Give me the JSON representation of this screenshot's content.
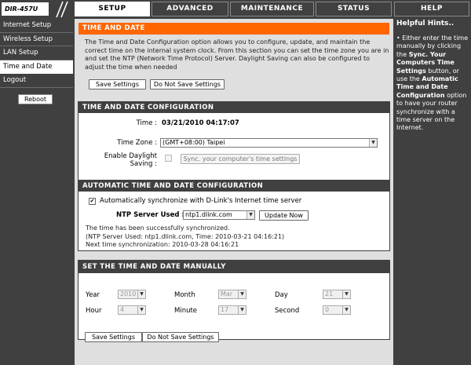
{
  "header": {
    "logo": "DIR-457U",
    "tabs": [
      {
        "label": "SETUP"
      },
      {
        "label": "ADVANCED"
      },
      {
        "label": "MAINTENANCE"
      },
      {
        "label": "STATUS"
      },
      {
        "label": "HELP"
      }
    ]
  },
  "sidebar": {
    "items": [
      {
        "label": "Internet Setup"
      },
      {
        "label": "Wireless Setup"
      },
      {
        "label": "LAN Setup"
      },
      {
        "label": "Time and Date"
      },
      {
        "label": "Logout"
      }
    ],
    "reboot_label": "Reboot"
  },
  "intro": {
    "title": "TIME AND DATE",
    "text": "The Time and Date Configuration option allows you to configure, update, and maintain the correct time on the internal system clock. From this section you can set the time zone you are in and set the NTP (Network Time Protocol) Server. Daylight Saving can also be configured to adjust the time when needed",
    "save_label": "Save Settings",
    "nosave_label": "Do Not Save Settings"
  },
  "config": {
    "title": "TIME AND DATE CONFIGURATION",
    "time_label": "Time :",
    "time_value": "03/21/2010 04:17:07",
    "timezone_label": "Time Zone :",
    "timezone_value": "(GMT+08:00) Taipei",
    "daylight_label_1": "Enable Daylight",
    "daylight_label_2": "Saving :",
    "sync_label": "Sync. your computer's time settings"
  },
  "auto": {
    "title": "AUTOMATIC TIME AND DATE CONFIGURATION",
    "checkbox_label": "Automatically synchronize with D-Link's Internet time server",
    "ntp_label": "NTP Server Used :",
    "ntp_value": "ntp1.dlink.com",
    "update_label": "Update Now",
    "status_1": "The time has been successfully synchronized.",
    "status_2": "(NTP Server Used: ntp1.dlink.com, Time: 2010-03-21 04:16:21)",
    "status_3": "Next time synchronization: 2010-03-28 04:16:21"
  },
  "manual": {
    "title": "SET THE TIME AND DATE MANUALLY",
    "year_label": "Year",
    "year_value": "2010",
    "month_label": "Month",
    "month_value": "Mar",
    "day_label": "Day",
    "day_value": "21",
    "hour_label": "Hour",
    "hour_value": "4",
    "minute_label": "Minute",
    "minute_value": "17",
    "second_label": "Second",
    "second_value": "0"
  },
  "footer": {
    "save_label": "Save Settings",
    "nosave_label": "Do Not Save Settings"
  },
  "hints": {
    "title": "Helpful Hints..",
    "bullet": "•",
    "p1": "Either enter the time manually by clicking the",
    "b1": "Sync. Your Computers Time Settings",
    "p2": "button, or use the",
    "b2": "Automatic Time and Date Configuration",
    "p3": "option to have your router synchronize with a time server on the Internet."
  },
  "colors": {
    "chrome": "#404040",
    "accent_orange": "#ff6600",
    "content_bg": "#dfdfdf"
  }
}
